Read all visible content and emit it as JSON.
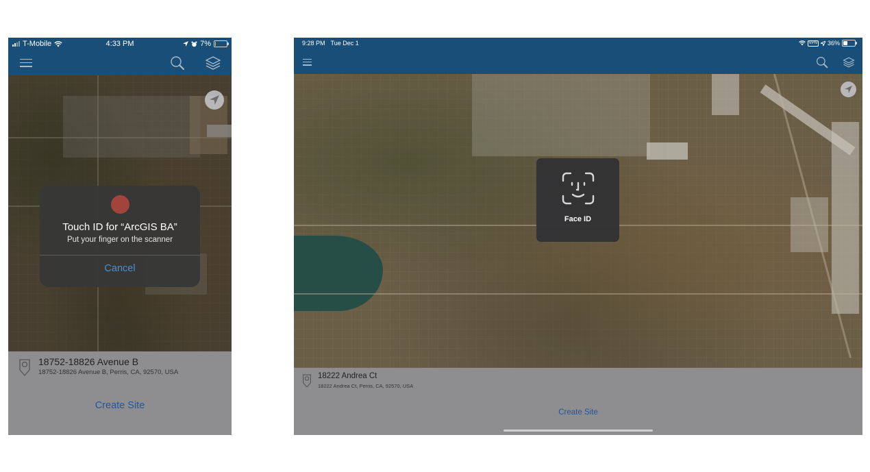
{
  "phone": {
    "status_bar": {
      "carrier": "T-Mobile",
      "time": "4:33 PM",
      "battery_percent_label": "7%",
      "battery_level": 0.07,
      "icons": [
        "signal-icon",
        "wifi-icon",
        "location-arrow-icon",
        "alarm-icon",
        "battery-icon"
      ]
    },
    "nav_bar": {
      "icons": [
        "menu-icon",
        "search-icon",
        "layers-icon"
      ]
    },
    "map": {
      "locate_icon": "location-arrow-icon"
    },
    "auth_dialog": {
      "title": "Touch ID for “ArcGIS BA”",
      "subtitle": "Put your finger on the scanner",
      "cancel_label": "Cancel",
      "indicator_color": "#a3443c"
    },
    "sheet": {
      "address_title": "18752-18826 Avenue B",
      "address_full": "18752-18826 Avenue B, Perris, CA, 92570, USA",
      "action_label": "Create Site"
    }
  },
  "tablet": {
    "status_bar": {
      "time": "9:28 PM",
      "date": "Tue Dec 1",
      "vpn_label": "VPN",
      "battery_percent_label": "36%",
      "battery_level": 0.36,
      "icons": [
        "wifi-icon",
        "vpn-icon",
        "location-arrow-icon",
        "battery-icon"
      ]
    },
    "nav_bar": {
      "icons": [
        "menu-icon",
        "search-icon",
        "layers-icon"
      ]
    },
    "map": {
      "locate_icon": "location-arrow-icon"
    },
    "auth_dialog": {
      "title": "Face ID"
    },
    "sheet": {
      "address_title": "18222 Andrea Ct",
      "address_full": "18222 Andrea Ct, Perris, CA, 92570, USA",
      "action_label": "Create Site"
    }
  },
  "colors": {
    "nav_bar": "#184e77",
    "sheet": "#8e8e91",
    "action_text": "#24559b",
    "cancel_text": "#4a8ed6"
  }
}
